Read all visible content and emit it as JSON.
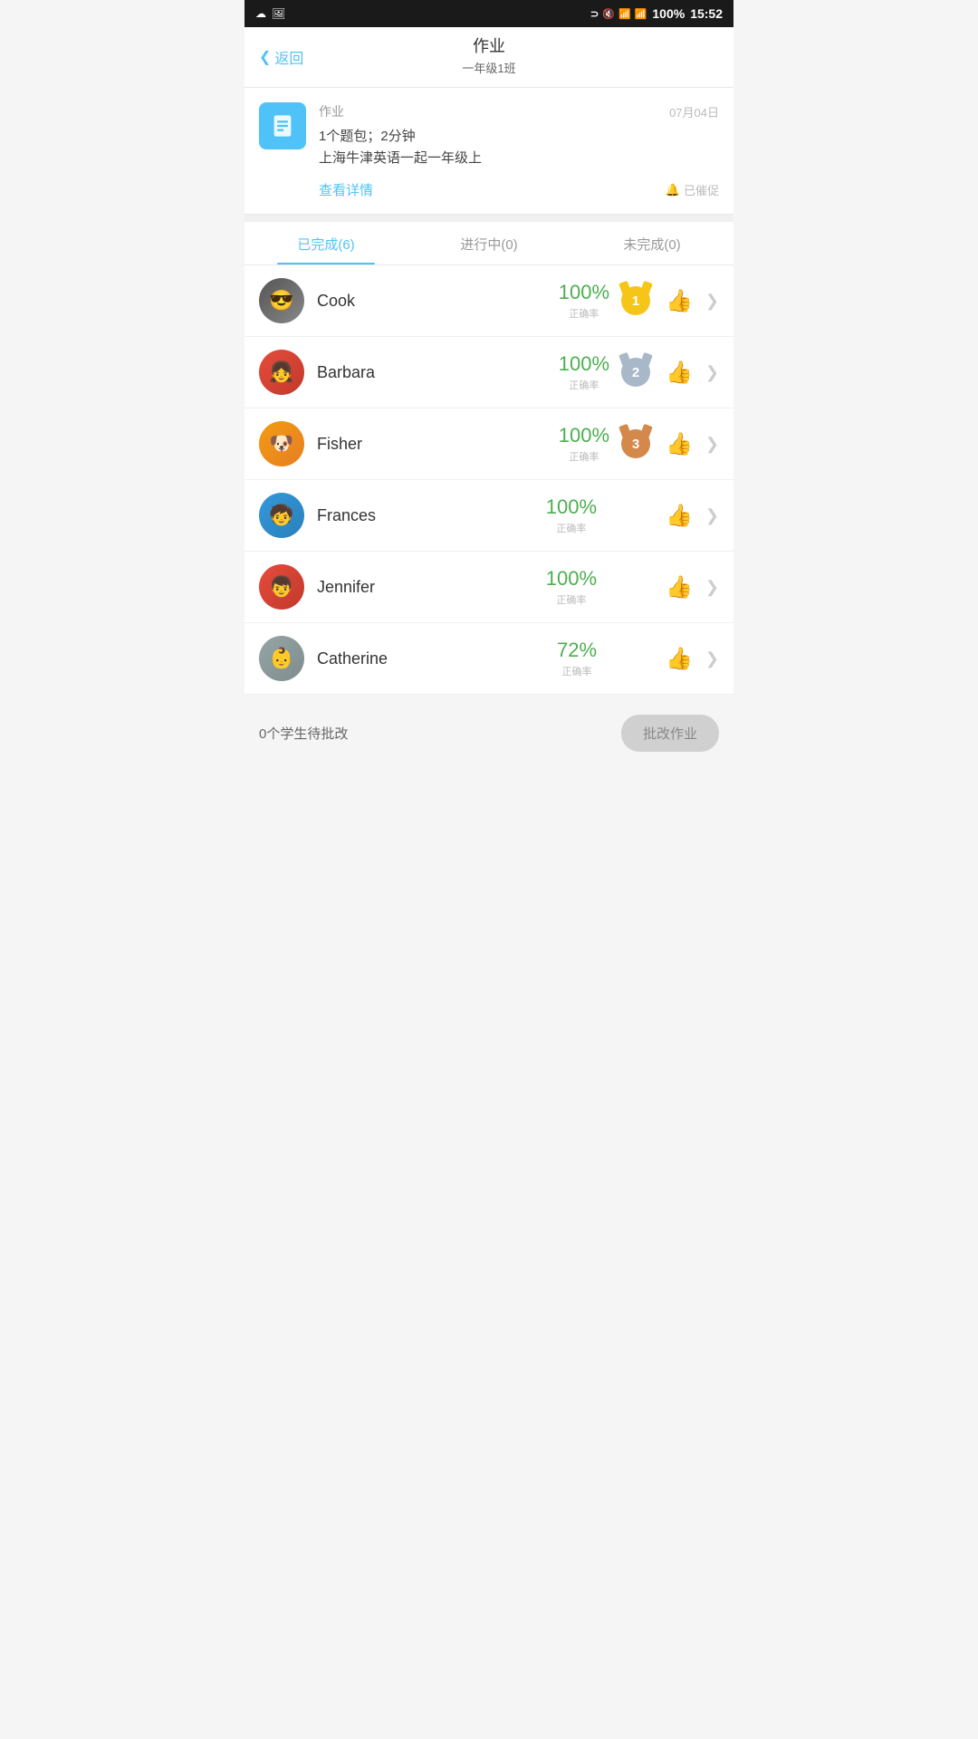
{
  "statusBar": {
    "time": "15:52",
    "battery": "100%"
  },
  "header": {
    "backLabel": "返回",
    "title": "作业",
    "subtitle": "一年级1班"
  },
  "assignment": {
    "label": "作业",
    "date": "07月04日",
    "desc1": "1个题包；2分钟",
    "desc2": "上海牛津英语一起一年级上",
    "viewDetail": "查看详情",
    "remindLabel": "已催促"
  },
  "tabs": [
    {
      "label": "已完成(6)",
      "active": true
    },
    {
      "label": "进行中(0)",
      "active": false
    },
    {
      "label": "未完成(0)",
      "active": false
    }
  ],
  "students": [
    {
      "name": "Cook",
      "score": "100%",
      "scoreLabel": "正确率",
      "rank": 1,
      "medal": "gold",
      "avatarClass": "avatar-cook",
      "avatarEmoji": "😎"
    },
    {
      "name": "Barbara",
      "score": "100%",
      "scoreLabel": "正确率",
      "rank": 2,
      "medal": "silver",
      "avatarClass": "avatar-barbara",
      "avatarEmoji": "👧"
    },
    {
      "name": "Fisher",
      "score": "100%",
      "scoreLabel": "正确率",
      "rank": 3,
      "medal": "bronze",
      "avatarClass": "avatar-fisher",
      "avatarEmoji": "🐶"
    },
    {
      "name": "Frances",
      "score": "100%",
      "scoreLabel": "正确率",
      "rank": 0,
      "medal": "",
      "avatarClass": "avatar-frances",
      "avatarEmoji": "🧒"
    },
    {
      "name": "Jennifer",
      "score": "100%",
      "scoreLabel": "正确率",
      "rank": 0,
      "medal": "",
      "avatarClass": "avatar-jennifer",
      "avatarEmoji": "👦"
    },
    {
      "name": "Catherine",
      "score": "72%",
      "scoreLabel": "正确率",
      "rank": 0,
      "medal": "",
      "avatarClass": "avatar-catherine",
      "avatarEmoji": "👶"
    }
  ],
  "footer": {
    "pendingLabel": "0个学生待批改",
    "gradeBtn": "批改作业"
  }
}
